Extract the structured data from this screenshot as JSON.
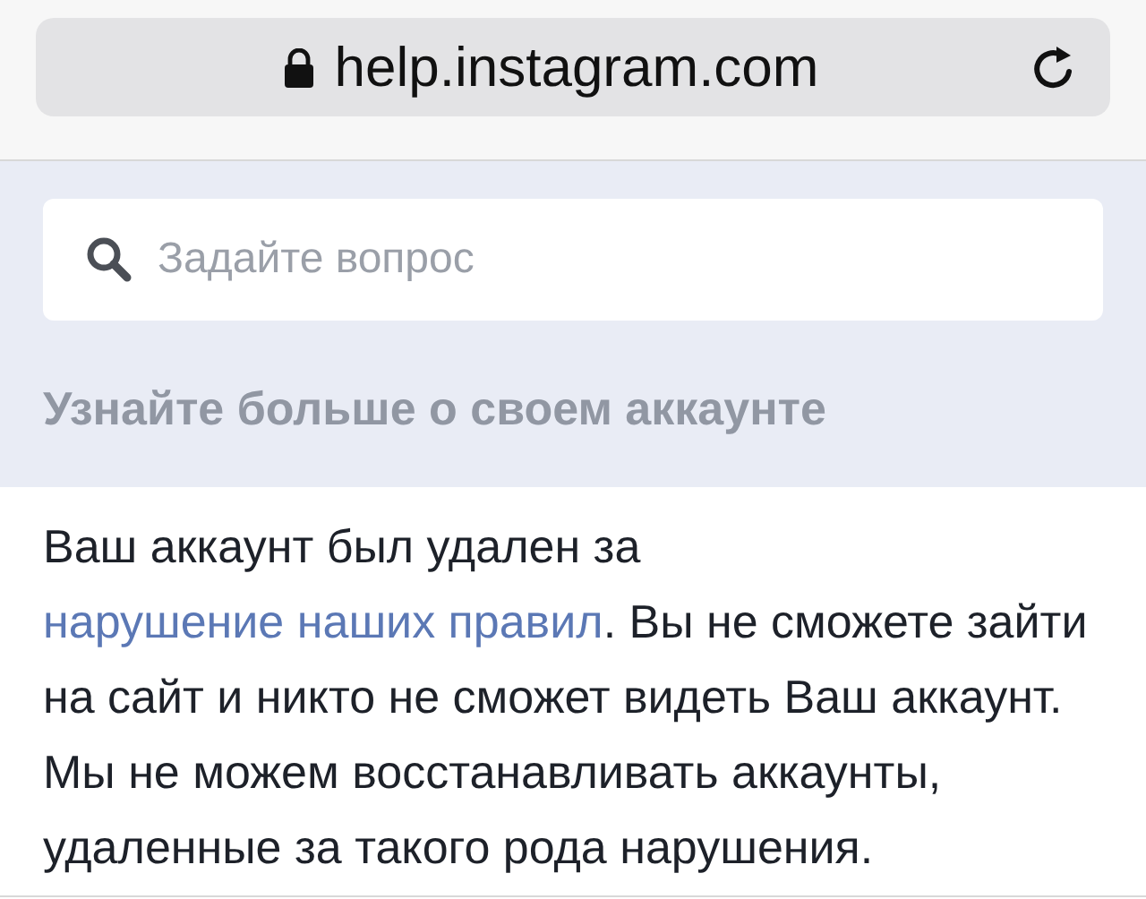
{
  "address_bar": {
    "url": "help.instagram.com"
  },
  "search": {
    "placeholder": "Задайте вопрос"
  },
  "section_heading": "Узнайте больше о своем аккаунте",
  "message": {
    "before": "Ваш аккаунт был удален за",
    "link": "нарушение наших правил",
    "after": ". Вы не сможете зайти на сайт и никто не сможет видеть Ваш аккаунт. Мы не можем восстанавливать аккаунты, удаленные за такого рода нарушения."
  }
}
